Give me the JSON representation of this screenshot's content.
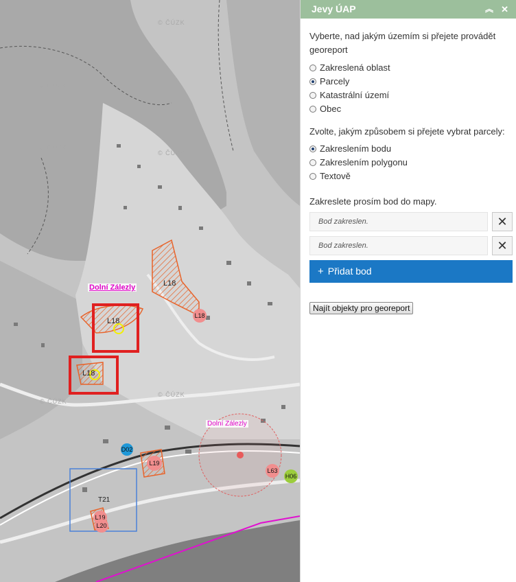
{
  "map": {
    "place_labels": [
      "Dolní Zálezly",
      "Dolní Zálezly"
    ],
    "watermark_text": "© ČÚZK",
    "zone_labels": [
      "L18",
      "L18",
      "L18",
      "L18",
      "L19",
      "L19",
      "L20",
      "L63",
      "T21",
      "D02",
      "H06"
    ]
  },
  "panel": {
    "title": "Jevy ÚAP",
    "collapse_icon": "chevron-double-up-icon",
    "close_icon": "close-icon",
    "intro": "Vyberte, nad jakým územím si přejete provádět georeport",
    "area_options": [
      {
        "label": "Zakreslená oblast",
        "checked": false
      },
      {
        "label": "Parcely",
        "checked": true
      },
      {
        "label": "Katastrální území",
        "checked": false
      },
      {
        "label": "Obec",
        "checked": false
      }
    ],
    "parcel_prompt": "Zvolte, jakým způsobem si přejete vybrat parcely:",
    "parcel_options": [
      {
        "label": "Zakreslením bodu",
        "checked": true
      },
      {
        "label": "Zakreslením polygonu",
        "checked": false
      },
      {
        "label": "Textově",
        "checked": false
      }
    ],
    "draw_prompt": "Zakreslete prosím bod do mapy.",
    "points": [
      "Bod zakreslen.",
      "Bod zakreslen."
    ],
    "remove_symbol": "✕",
    "add_point_label": "Přidat bod",
    "add_symbol": "+",
    "find_label": "Najít objekty pro georeport"
  }
}
